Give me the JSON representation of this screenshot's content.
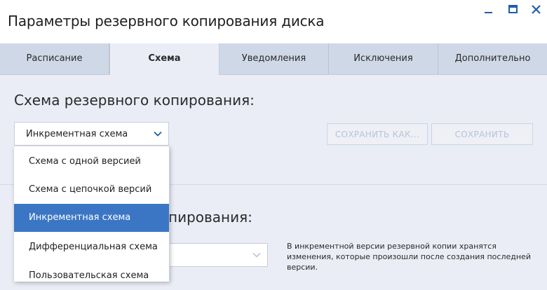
{
  "window": {
    "title": "Параметры резервного копирования диска",
    "accent": "#1f5ea8"
  },
  "tabs": [
    {
      "label": "Расписание",
      "active": false
    },
    {
      "label": "Схема",
      "active": true
    },
    {
      "label": "Уведомления",
      "active": false
    },
    {
      "label": "Исключения",
      "active": false
    },
    {
      "label": "Дополнительно",
      "active": false
    }
  ],
  "scheme": {
    "heading": "Схема резервного копирования:",
    "selected": "Инкрементная схема",
    "options": [
      "Схема с одной версией",
      "Схема с цепочкой версий",
      "Инкрементная схема",
      "Дифференциальная схема",
      "Пользовательская схема"
    ],
    "selected_index": 2,
    "highlight_color": "#3b76c4"
  },
  "buttons": {
    "save_as": "СОХРАНИТЬ КАК...",
    "save": "СОХРАНИТЬ"
  },
  "section2": {
    "heading_partial": "пирования:",
    "description": "В инкрементной версии резервной копии хранятся изменения, которые произошли после создания последней версии."
  }
}
